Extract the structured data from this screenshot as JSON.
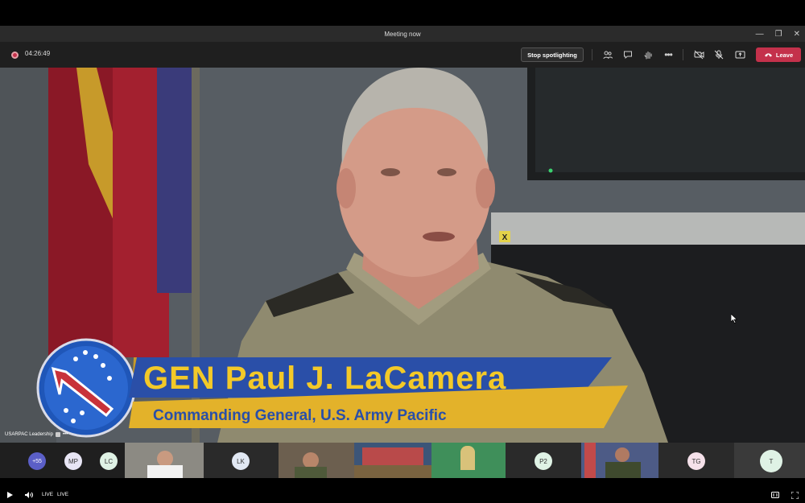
{
  "window": {
    "title": "Meeting now",
    "minimize": "—",
    "restore": "❐",
    "close": "✕"
  },
  "toolbar": {
    "timer": "04:26:49",
    "stop_spotlight": "Stop spotlighting",
    "leave": "Leave"
  },
  "video": {
    "name_banner": "GEN Paul J. LaCamera",
    "title_banner": "Commanding General,  U.S. Army Pacific",
    "tile_label": "USARPAC Leadership",
    "flag_tag": "X"
  },
  "strip": {
    "more_count": "+55",
    "avatars": [
      "MP",
      "LC",
      "LK",
      "P2",
      "TG",
      "T"
    ]
  },
  "player": {
    "live1": "LIVE",
    "live2": "LIVE"
  },
  "colors": {
    "leave": "#c4314b",
    "banner_text": "#f3c928",
    "banner_blue": "#2a4fa8",
    "banner_gold": "#e3b22a"
  }
}
